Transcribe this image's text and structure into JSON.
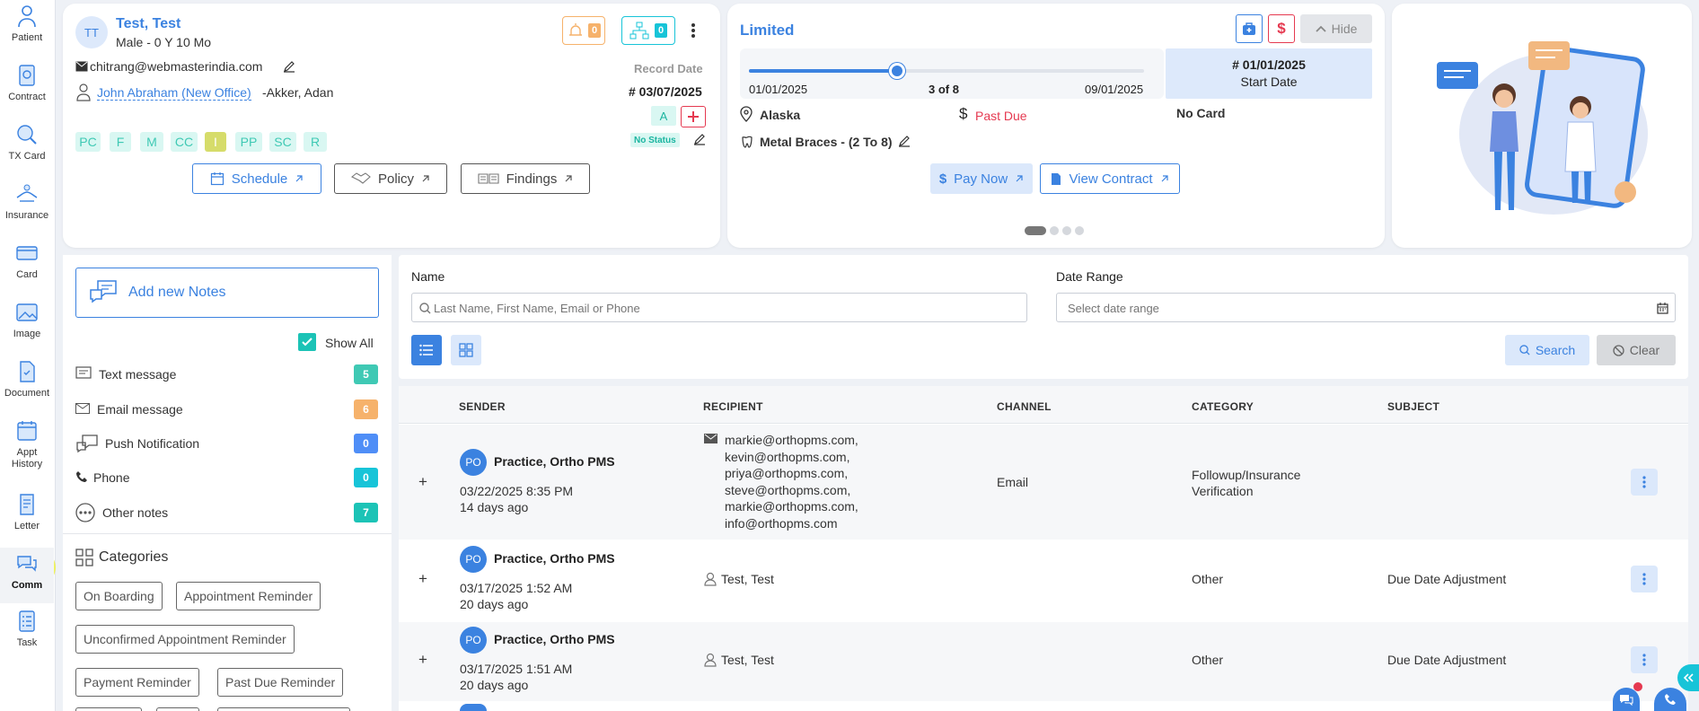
{
  "sidebar": {
    "items": [
      {
        "label": "Patient",
        "icon": "patient-icon"
      },
      {
        "label": "Contract",
        "icon": "contract-icon"
      },
      {
        "label": "TX Card",
        "icon": "tx-card-icon"
      },
      {
        "label": "Insurance",
        "icon": "insurance-icon"
      },
      {
        "label": "Card",
        "icon": "card-icon"
      },
      {
        "label": "Image",
        "icon": "image-icon"
      },
      {
        "label": "Document",
        "icon": "document-icon"
      },
      {
        "label": "Appt History",
        "icon": "appt-history-icon"
      },
      {
        "label": "Letter",
        "icon": "letter-icon"
      },
      {
        "label": "Comm",
        "icon": "comm-icon"
      },
      {
        "label": "Task",
        "icon": "task-icon"
      }
    ]
  },
  "patient": {
    "initials": "TT",
    "name": "Test, Test",
    "demographics": "Male - 0 Y 10 Mo",
    "alert_count": "0",
    "hierarchy_count": "0",
    "email": "chitrang@webmasterindia.com",
    "provider_link": "John Abraham (New Office)",
    "provider_suffix": "-Akker, Adan",
    "record_date_label": "Record Date",
    "record_date": "# 03/07/2025",
    "status_letter": "A",
    "status": "No Status",
    "tags": [
      "PC",
      "F",
      "M",
      "CC",
      "I",
      "PP",
      "SC",
      "R"
    ],
    "buttons": {
      "schedule": "Schedule",
      "policy": "Policy",
      "findings": "Findings"
    }
  },
  "contract": {
    "title": "Limited",
    "hide_label": "Hide",
    "start_value": "01/01/2025",
    "end_value": "09/01/2025",
    "progress_label": "3 of 8",
    "progress_fraction": 0.375,
    "start_date_value": "# 01/01/2025",
    "start_date_label": "Start Date",
    "state": "Alaska",
    "due_status": "Past Due",
    "card_status": "No Card",
    "appliance": "Metal Braces - (2 To 8)",
    "pay_now": "Pay Now",
    "view_contract": "View Contract",
    "colors": {
      "accent": "#3b82e0",
      "danger": "#e53950"
    }
  },
  "notes_panel": {
    "add_label": "Add new Notes",
    "show_all_label": "Show All",
    "types": [
      {
        "label": "Text message",
        "count": "5",
        "color": "#3fc9b4"
      },
      {
        "label": "Email message",
        "count": "6",
        "color": "#f6b26b"
      },
      {
        "label": "Push Notification",
        "count": "0",
        "color": "#4f8ef7"
      },
      {
        "label": "Phone",
        "count": "0",
        "color": "#17c4d8"
      },
      {
        "label": "Other notes",
        "count": "7",
        "color": "#1cc3b6"
      }
    ],
    "categories_title": "Categories",
    "categories": [
      "On Boarding",
      "Appointment Reminder",
      "Unconfirmed Appointment Reminder",
      "Payment Reminder",
      "Past Due Reminder"
    ]
  },
  "filters": {
    "name_label": "Name",
    "name_placeholder": "Last Name, First Name, Email or Phone",
    "date_label": "Date Range",
    "date_placeholder": "Select date range",
    "search": "Search",
    "clear": "Clear"
  },
  "table": {
    "headers": {
      "sender": "SENDER",
      "recipient": "RECIPIENT",
      "channel": "CHANNEL",
      "category": "CATEGORY",
      "subject": "SUBJECT"
    },
    "rows": [
      {
        "expand": "+",
        "initials": "PO",
        "sender": "Practice, Ortho PMS",
        "datetime": "03/22/2025 8:35 PM",
        "ago": "14 days ago",
        "recipients": [
          "markie@orthopms.com,",
          "kevin@orthopms.com,",
          "priya@orthopms.com,",
          "steve@orthopms.com,",
          "markie@orthopms.com,",
          "info@orthopms.com"
        ],
        "channel": "Email",
        "category": [
          "Followup/Insurance",
          "Verification"
        ],
        "subject": ""
      },
      {
        "expand": "+",
        "initials": "PO",
        "sender": "Practice, Ortho PMS",
        "datetime": "03/17/2025 1:52 AM",
        "ago": "20 days ago",
        "recipient": "Test, Test",
        "channel": "",
        "category": "Other",
        "subject": "Due Date Adjustment"
      },
      {
        "expand": "+",
        "initials": "PO",
        "sender": "Practice, Ortho PMS",
        "datetime": "03/17/2025 1:51 AM",
        "ago": "20 days ago",
        "recipient": "Test, Test",
        "channel": "",
        "category": "Other",
        "subject": "Due Date Adjustment"
      }
    ]
  }
}
